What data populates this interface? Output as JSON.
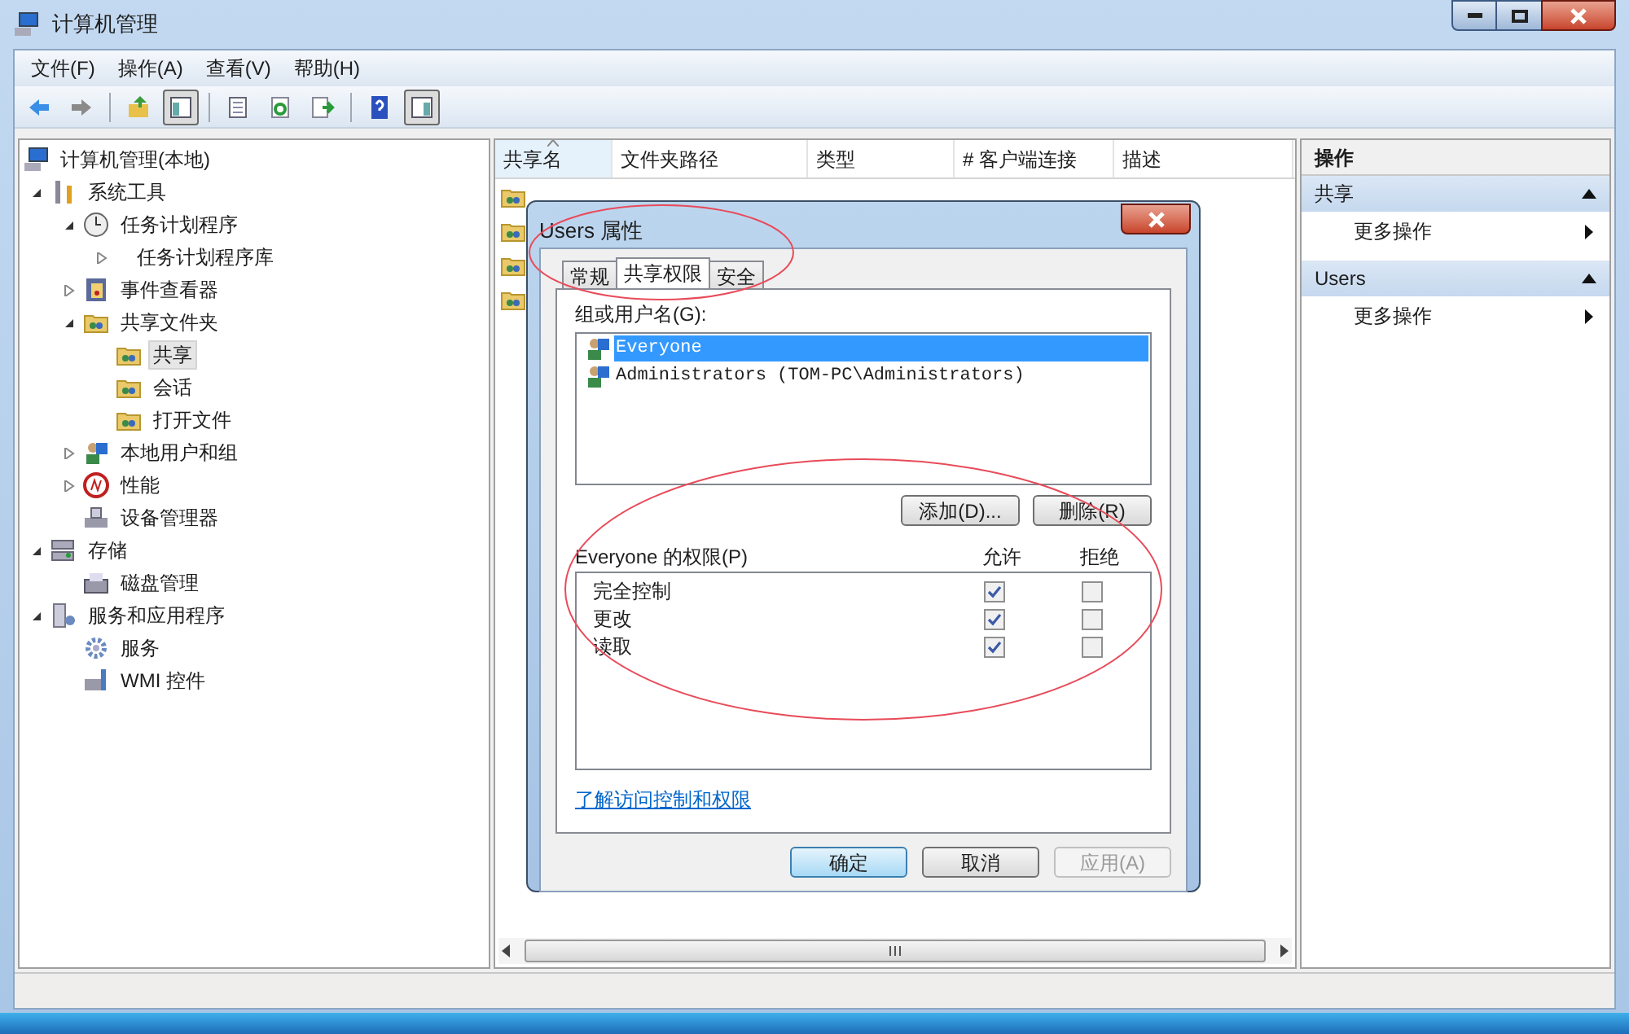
{
  "window": {
    "title": "计算机管理"
  },
  "menu": [
    "文件(F)",
    "操作(A)",
    "查看(V)",
    "帮助(H)"
  ],
  "toolbar": [
    {
      "kind": "back",
      "pressed": false
    },
    {
      "kind": "forward",
      "pressed": false
    },
    {
      "kind": "sep"
    },
    {
      "kind": "up",
      "pressed": false
    },
    {
      "kind": "tree",
      "pressed": true
    },
    {
      "kind": "sep"
    },
    {
      "kind": "props",
      "pressed": false
    },
    {
      "kind": "refresh",
      "pressed": false
    },
    {
      "kind": "export",
      "pressed": false
    },
    {
      "kind": "sep"
    },
    {
      "kind": "help",
      "pressed": false
    },
    {
      "kind": "pane",
      "pressed": true
    }
  ],
  "tree": {
    "label": "计算机管理(本地)",
    "kind": "computer",
    "selected": false,
    "children": [
      {
        "label": "系统工具",
        "kind": "tools",
        "expanded": true,
        "selected": false,
        "children": [
          {
            "label": "任务计划程序",
            "kind": "clock",
            "expanded": true,
            "selected": false,
            "children": [
              {
                "label": "任务计划程序库",
                "kind": "none",
                "expanded": false,
                "selected": false
              }
            ]
          },
          {
            "label": "事件查看器",
            "kind": "event",
            "expanded": false,
            "selected": false
          },
          {
            "label": "共享文件夹",
            "kind": "share",
            "expanded": true,
            "selected": false,
            "children": [
              {
                "label": "共享",
                "kind": "share",
                "selected": true
              },
              {
                "label": "会话",
                "kind": "share",
                "selected": false
              },
              {
                "label": "打开文件",
                "kind": "share",
                "selected": false
              }
            ]
          },
          {
            "label": "本地用户和组",
            "kind": "users",
            "expanded": false,
            "selected": false
          },
          {
            "label": "性能",
            "kind": "perf",
            "expanded": false,
            "selected": false
          },
          {
            "label": "设备管理器",
            "kind": "device",
            "selected": false
          }
        ]
      },
      {
        "label": "存储",
        "kind": "storage",
        "expanded": true,
        "selected": false,
        "children": [
          {
            "label": "磁盘管理",
            "kind": "disk",
            "selected": false
          }
        ]
      },
      {
        "label": "服务和应用程序",
        "kind": "server",
        "expanded": true,
        "selected": false,
        "children": [
          {
            "label": "服务",
            "kind": "gear",
            "selected": false
          },
          {
            "label": "WMI 控件",
            "kind": "wmi",
            "selected": false
          }
        ]
      }
    ]
  },
  "table": {
    "columns": [
      {
        "label": "共享名",
        "sorted": true
      },
      {
        "label": "文件夹路径",
        "sorted": false
      },
      {
        "label": "类型",
        "sorted": false
      },
      {
        "label": "# 客户端连接",
        "sorted": false
      },
      {
        "label": "描述",
        "sorted": false
      }
    ],
    "rows": [
      {
        "kind": "share"
      },
      {
        "kind": "share"
      },
      {
        "kind": "share"
      },
      {
        "kind": "share"
      }
    ]
  },
  "actions": {
    "title": "操作",
    "sections": [
      {
        "title": "共享",
        "expanded": true,
        "items": [
          "更多操作"
        ]
      },
      {
        "title": "Users",
        "expanded": true,
        "items": [
          "更多操作"
        ]
      }
    ]
  },
  "dialog": {
    "title": "Users 属性",
    "tabs": [
      {
        "label": "常规",
        "selected": false
      },
      {
        "label": "共享权限",
        "selected": true
      },
      {
        "label": "安全",
        "selected": false
      }
    ],
    "group_label": "组或用户名(G):",
    "principals": [
      {
        "name": "Everyone",
        "selected": true
      },
      {
        "name": "Administrators (TOM-PC\\Administrators)",
        "selected": false
      }
    ],
    "add_button": "添加(D)...",
    "remove_button": "删除(R)",
    "permissions_label": "Everyone 的权限(P)",
    "allow_label": "允许",
    "deny_label": "拒绝",
    "permissions": [
      {
        "name": "完全控制",
        "allow": true,
        "deny": false
      },
      {
        "name": "更改",
        "allow": true,
        "deny": false
      },
      {
        "name": "读取",
        "allow": true,
        "deny": false
      }
    ],
    "link": "了解访问控制和权限",
    "buttons": [
      {
        "label": "确定",
        "default": true,
        "disabled": false
      },
      {
        "label": "取消",
        "default": false,
        "disabled": false
      },
      {
        "label": "应用(A)",
        "default": false,
        "disabled": true
      }
    ]
  }
}
